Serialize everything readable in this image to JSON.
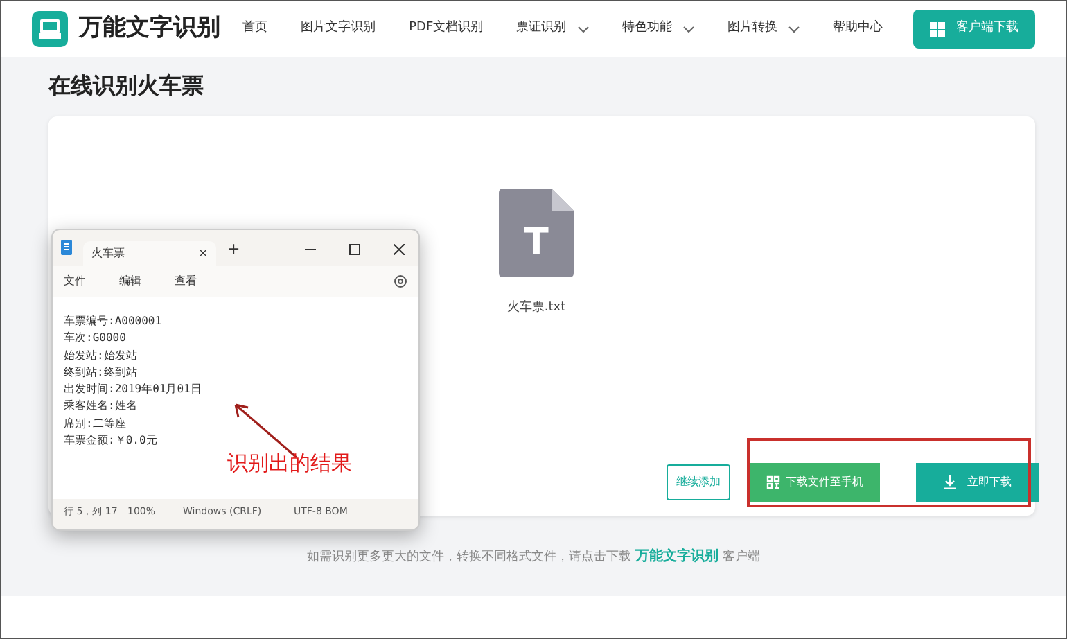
{
  "brand": {
    "name": "万能文字识别"
  },
  "nav": [
    {
      "label": "首页",
      "has_menu": false
    },
    {
      "label": "图片文字识别",
      "has_menu": false
    },
    {
      "label": "PDF文档识别",
      "has_menu": false
    },
    {
      "label": "票证识别",
      "has_menu": true
    },
    {
      "label": "特色功能",
      "has_menu": true
    },
    {
      "label": "图片转换",
      "has_menu": true
    },
    {
      "label": "帮助中心",
      "has_menu": false
    }
  ],
  "header_button": "客户端下载",
  "page_title": "在线识别火车票",
  "file": {
    "name": "火车票.txt",
    "letter": "T"
  },
  "notepad": {
    "tab": "火车票",
    "tab_close": "×",
    "new_tab": "+",
    "menus": [
      "文件",
      "编辑",
      "查看"
    ],
    "lines": [
      "车票编号:A000001",
      "车次:G0000",
      "始发站:始发站",
      "终到站:终到站",
      "出发时间:2019年01月01日",
      "乘客姓名:姓名",
      "席别:二等座",
      "车票金额:￥0.0元"
    ],
    "status": [
      "行 5，列 17",
      "100%",
      "Windows (CRLF)",
      "UTF-8 BOM"
    ]
  },
  "annotation": "识别出的结果",
  "buttons": {
    "add": "继续添加",
    "phone": "下载文件至手机",
    "download": "立即下载"
  },
  "footer": {
    "before": "如需识别更多更大的文件，转换不同格式文件，请点击下载",
    "link": "万能文字识别",
    "after": "客户端"
  }
}
